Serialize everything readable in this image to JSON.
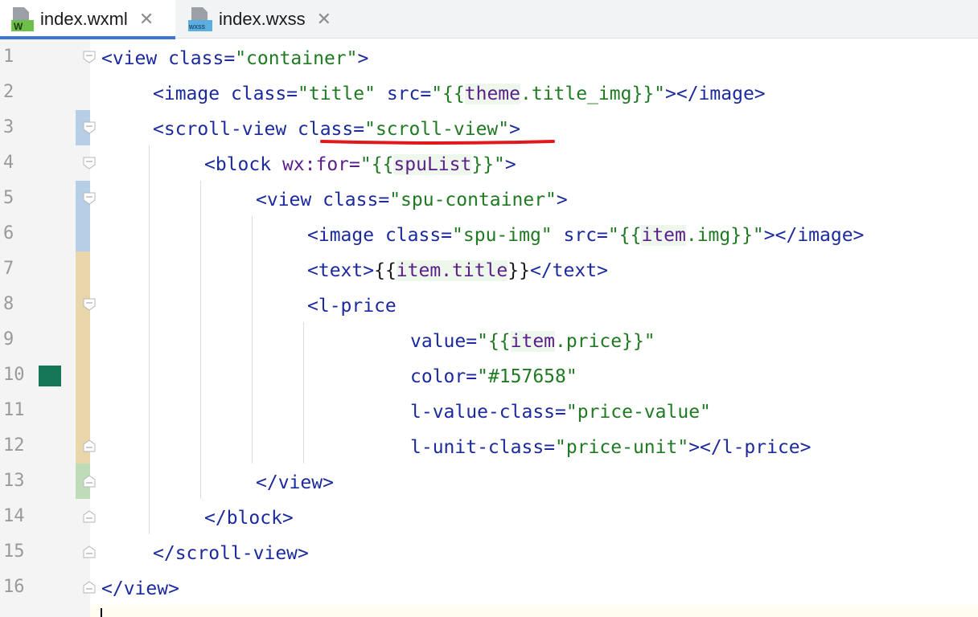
{
  "tabs": [
    {
      "label": "index.wxml",
      "icon": "wxml-file-icon",
      "icon_badge": "W",
      "active": true
    },
    {
      "label": "index.wxss",
      "icon": "wxss-file-icon",
      "icon_badge": "wxss",
      "active": false
    }
  ],
  "close_glyph": "✕",
  "line_numbers": [
    "1",
    "2",
    "3",
    "4",
    "5",
    "6",
    "7",
    "8",
    "9",
    "10",
    "11",
    "12",
    "13",
    "14",
    "15",
    "16"
  ],
  "code": {
    "l1": [
      "<view ",
      "class=",
      "\"container\"",
      ">"
    ],
    "l2": [
      "<image ",
      "class=",
      "\"title\" ",
      "src=",
      "\"{{",
      "theme",
      ".title_img}}\"",
      "></image>"
    ],
    "l3": [
      "<scroll-view ",
      "class=",
      "\"scroll-view\"",
      ">"
    ],
    "l4": [
      "<block ",
      "wx:for=",
      "\"{{",
      "spuList",
      "}}\"",
      ">"
    ],
    "l5": [
      "<view ",
      "class=",
      "\"spu-container\"",
      ">"
    ],
    "l6": [
      "<image ",
      "class=",
      "\"spu-img\" ",
      "src=",
      "\"{{",
      "item",
      ".img}}\"",
      "></image>"
    ],
    "l7": [
      "<text>",
      "{{",
      "item.title",
      "}}",
      "</text>"
    ],
    "l8": [
      "<l-price"
    ],
    "l9": [
      "value=",
      "\"{{",
      "item",
      ".price}}\""
    ],
    "l10": [
      "color=",
      "\"#157658\""
    ],
    "l11": [
      "l-value-class=",
      "\"price-value\""
    ],
    "l12": [
      "l-unit-class=",
      "\"price-unit\"",
      "></l-price>"
    ],
    "l13": [
      "</view>"
    ],
    "l14": [
      "</block>"
    ],
    "l15": [
      "</scroll-view>"
    ],
    "l16": [
      "</view>"
    ]
  },
  "colors": {
    "tag": "#1b2a9c",
    "string": "#1f7a22",
    "mustache_var": "#5c1f8a",
    "underline": "#e0191c",
    "color_swatch": "#157658",
    "vcs_modified": "#b7cfe6",
    "vcs_changed": "#e9d6aa",
    "vcs_added": "#bfdcb9",
    "tab_active_indicator": "#3d74d6"
  }
}
